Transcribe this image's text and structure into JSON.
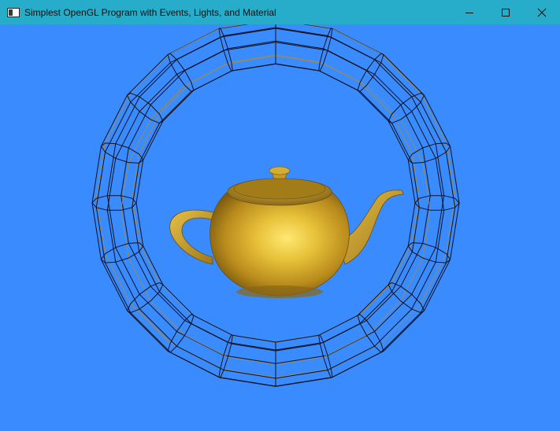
{
  "window": {
    "title": "Simplest OpenGL Program with Events, Lights, and Material",
    "controls": {
      "minimize": "minimize-icon",
      "maximize": "maximize-icon",
      "close": "close-icon"
    }
  },
  "scene": {
    "background_color": "#3a8cfe",
    "objects": [
      {
        "name": "teapot",
        "style": "solid gold material"
      },
      {
        "name": "torus",
        "style": "wireframe"
      }
    ]
  },
  "colors": {
    "titlebar": "#27adc9",
    "gold": "#d8aa2c",
    "wire": "#101020"
  }
}
